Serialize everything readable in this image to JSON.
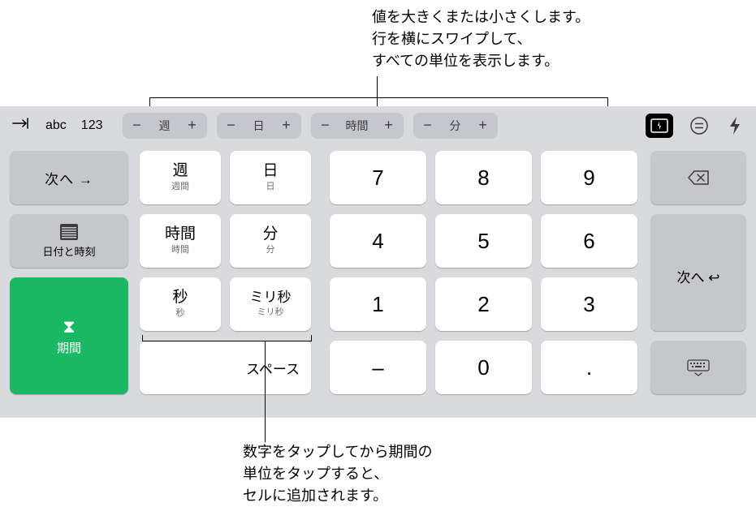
{
  "callouts": {
    "top": "値を大きくまたは小さくします。\n行を横にスワイプして、\nすべての単位を表示します。",
    "bottom": "数字をタップしてから期間の\n単位をタップすると、\nセルに追加されます。"
  },
  "toolbar": {
    "abc": "abc",
    "num": "123",
    "steppers": [
      {
        "label": "週"
      },
      {
        "label": "日"
      },
      {
        "label": "時間"
      },
      {
        "label": "分"
      }
    ]
  },
  "left_keys": {
    "next": "次へ →",
    "datetime": "日付と時刻",
    "duration": "期間"
  },
  "unit_keys": [
    {
      "main": "週",
      "sub": "週間"
    },
    {
      "main": "日",
      "sub": "日"
    },
    {
      "main": "時間",
      "sub": "時間"
    },
    {
      "main": "分",
      "sub": "分"
    },
    {
      "main": "秒",
      "sub": "秒"
    },
    {
      "main": "ミリ秒",
      "sub": "ミリ秒"
    }
  ],
  "num_keys": {
    "7": "7",
    "8": "8",
    "9": "9",
    "4": "4",
    "5": "5",
    "6": "6",
    "1": "1",
    "2": "2",
    "3": "3",
    "minus": "–",
    "0": "0",
    "dot": "."
  },
  "space": "スペース",
  "enter": "次へ ↩︎"
}
